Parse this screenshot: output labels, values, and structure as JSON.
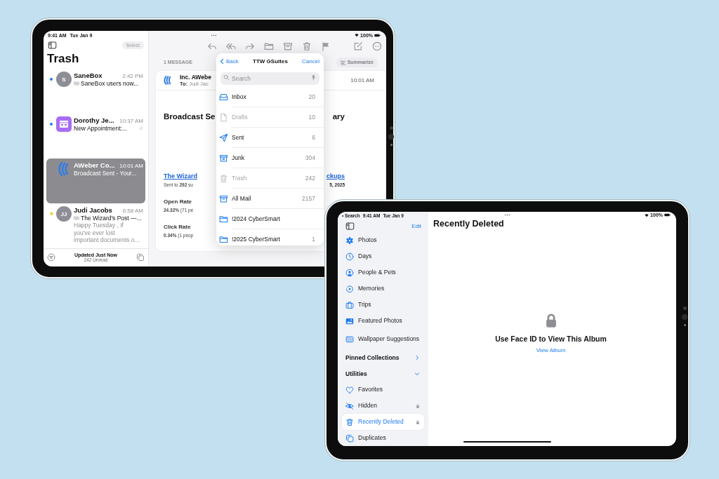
{
  "mail_ipad": {
    "status_bar": {
      "time": "9:41 AM",
      "date": "Tue Jan 9",
      "battery": "100%"
    },
    "sidebar": {
      "select_button": "Select",
      "title": "Trash",
      "messages": [
        {
          "sender": "SaneBox",
          "time": "2:42 PM",
          "subject": "SaneBox users now...",
          "unread": true,
          "starred": false,
          "avatar": {
            "kind": "initials",
            "text": "S"
          },
          "tagged": true,
          "attachment": false,
          "selected": false
        },
        {
          "sender": "Dorothy Je...",
          "time": "10:37 AM",
          "subject": "New Appointment:...",
          "unread": true,
          "starred": false,
          "avatar": {
            "kind": "calendar"
          },
          "tagged": false,
          "attachment": true,
          "selected": false
        },
        {
          "sender": "AWeber Co...",
          "time": "10:01 AM",
          "subject": "Broadcast Sent - Your...",
          "unread": false,
          "starred": false,
          "avatar": {
            "kind": "logo"
          },
          "tagged": false,
          "attachment": false,
          "selected": true
        },
        {
          "sender": "Judi Jacobs",
          "time": "6:58 AM",
          "subject": "The Wizard's Post —...",
          "preview_lines": [
            "Happy Tuesday , If",
            "you've ever lost",
            "important documents o..."
          ],
          "unread": false,
          "starred": true,
          "avatar": {
            "kind": "initials",
            "text": "JJ"
          },
          "tagged": true,
          "attachment": false,
          "selected": false
        }
      ],
      "footer": {
        "status": "Updated Just Now",
        "unread": "242 Unread"
      }
    },
    "detail": {
      "message_count": "1 MESSAGE",
      "summarize_button": "Summarize",
      "message": {
        "from": "Inc. AWebe",
        "to_label": "To:",
        "to": "Judi Jac",
        "time": "10:01 AM"
      },
      "body": [
        {
          "kind": "heading",
          "left": "Broadcast Se",
          "right": "ary"
        },
        {
          "kind": "link",
          "left": "The Wizard",
          "right": "ckups"
        },
        {
          "kind": "meta",
          "left": "Sent to **292** su",
          "right": "5, 2025"
        },
        {
          "kind": "label",
          "left": "Open Rate"
        },
        {
          "kind": "stat",
          "left": "**24.32%** (71 pe"
        },
        {
          "kind": "label",
          "left": "Click Rate"
        },
        {
          "kind": "stat",
          "left": "**0.34%** (1 peop"
        }
      ]
    },
    "move_popover": {
      "back": "Back",
      "title": "TTW GSuites",
      "cancel": "Cancel",
      "search_placeholder": "Search",
      "folders": [
        {
          "name": "Inbox",
          "count": "20",
          "disabled": false
        },
        {
          "name": "Drafts",
          "count": "10",
          "disabled": true
        },
        {
          "name": "Sent",
          "count": "6",
          "disabled": false
        },
        {
          "name": "Junk",
          "count": "304",
          "disabled": false
        },
        {
          "name": "Trash",
          "count": "242",
          "disabled": true
        },
        {
          "name": "All Mail",
          "count": "2157",
          "disabled": false
        },
        {
          "name": "!2024 CyberSmart",
          "disabled": false
        },
        {
          "name": "!2025 CyberSmart",
          "count": "1",
          "disabled": false
        }
      ]
    }
  },
  "photos_ipad": {
    "status_bar": {
      "back": "Search",
      "time": "9:41 AM",
      "date": "Tue Jan 9",
      "battery": "100%"
    },
    "sidebar": {
      "edit": "Edit",
      "items": [
        {
          "kind": "item",
          "label": "Photos",
          "selected": false,
          "locked": false
        },
        {
          "kind": "item",
          "label": "Days",
          "selected": false,
          "locked": false
        },
        {
          "kind": "item",
          "label": "People & Pets",
          "selected": false,
          "locked": false
        },
        {
          "kind": "item",
          "label": "Memories",
          "selected": false,
          "locked": false
        },
        {
          "kind": "item",
          "label": "Trips",
          "selected": false,
          "locked": false
        },
        {
          "kind": "item",
          "label": "Featured Photos",
          "selected": false,
          "locked": false
        },
        {
          "kind": "item",
          "label": "Wallpaper Suggestions",
          "selected": false,
          "locked": false
        },
        {
          "kind": "section",
          "label": "Pinned Collections",
          "expanded": false
        },
        {
          "kind": "section",
          "label": "Utilities",
          "expanded": true
        },
        {
          "kind": "item",
          "label": "Favorites",
          "selected": false,
          "locked": false
        },
        {
          "kind": "item",
          "label": "Hidden",
          "selected": false,
          "locked": true
        },
        {
          "kind": "item",
          "label": "Recently Deleted",
          "selected": true,
          "locked": true
        },
        {
          "kind": "item",
          "label": "Duplicates",
          "selected": false,
          "locked": false
        }
      ]
    },
    "main": {
      "title": "Recently Deleted",
      "message": "Use Face ID to View This Album",
      "link": "View Album"
    }
  }
}
